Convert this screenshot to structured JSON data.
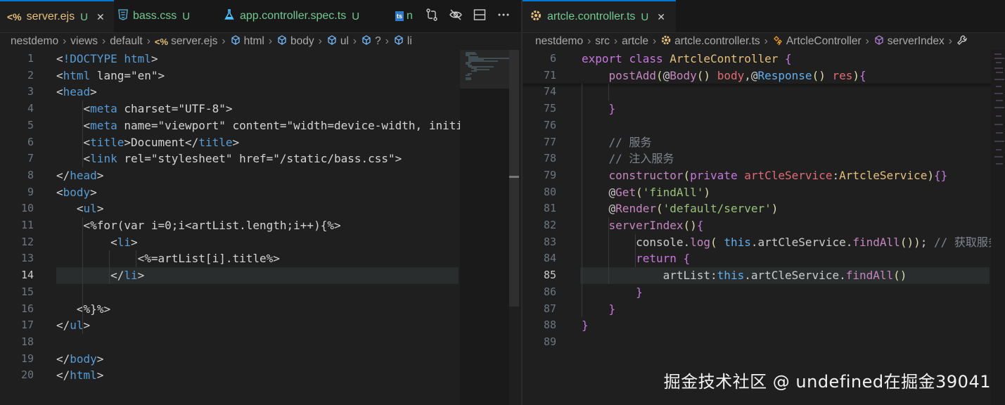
{
  "left_editor": {
    "tabs": [
      {
        "icon": "<%",
        "label": "server.ejs",
        "status": "U",
        "close": "✕",
        "active": true
      },
      {
        "icon": "css-icon",
        "label": "bass.css",
        "status": "U",
        "active": false
      },
      {
        "icon": "flask-icon",
        "label": "app.controller.spec.ts",
        "status": "U",
        "active": false
      },
      {
        "icon": "ts",
        "label": "n",
        "active": false
      }
    ],
    "breadcrumb": [
      "nestdemo",
      "views",
      "default",
      "server.ejs",
      "html",
      "body",
      "ul",
      "?",
      "li"
    ],
    "breadcrumb_ejs_icon": "<%",
    "lines": [
      {
        "n": "1",
        "text": "<!DOCTYPE html>"
      },
      {
        "n": "2",
        "text": "<html lang=\"en\">"
      },
      {
        "n": "3",
        "text": "<head>"
      },
      {
        "n": "4",
        "text": "    <meta charset=\"UTF-8\">"
      },
      {
        "n": "5",
        "text": "    <meta name=\"viewport\" content=\"width=device-width, initi"
      },
      {
        "n": "6",
        "text": "    <title>Document</title>"
      },
      {
        "n": "7",
        "text": "    <link rel=\"stylesheet\" href=\"/static/bass.css\">"
      },
      {
        "n": "8",
        "text": "</head>"
      },
      {
        "n": "9",
        "text": "<body>"
      },
      {
        "n": "10",
        "text": "   <ul>"
      },
      {
        "n": "11",
        "text": "    <%for(var i=0;i<artList.length;i++){%>"
      },
      {
        "n": "12",
        "text": "        <li>"
      },
      {
        "n": "13",
        "text": "            <%=artList[i].title%>"
      },
      {
        "n": "14",
        "text": "        </li>"
      },
      {
        "n": "15",
        "text": ""
      },
      {
        "n": "16",
        "text": "   <%}%>"
      },
      {
        "n": "17",
        "text": "</ul>"
      },
      {
        "n": "18",
        "text": ""
      },
      {
        "n": "19",
        "text": "</body>"
      },
      {
        "n": "20",
        "text": "</html>"
      }
    ],
    "current_line": "14"
  },
  "right_editor": {
    "tab": {
      "label": "artcle.controller.ts",
      "status": "U",
      "close": "✕"
    },
    "breadcrumb": [
      "nestdemo",
      "src",
      "artcle",
      "artcle.controller.ts",
      "ArtcleController",
      "serverIndex"
    ],
    "sticky_lines": [
      {
        "n": "6",
        "text": "export class ArtcleController {"
      },
      {
        "n": "71",
        "text": "    postAdd(@Body() body,@Response() res){"
      }
    ],
    "lines": [
      {
        "n": "74",
        "text": ""
      },
      {
        "n": "75",
        "text": "    }"
      },
      {
        "n": "76",
        "text": ""
      },
      {
        "n": "77",
        "text": "    // 服务"
      },
      {
        "n": "78",
        "text": "    // 注入服务"
      },
      {
        "n": "79",
        "text": "    constructor(private artCleService:ArtcleService){}"
      },
      {
        "n": "80",
        "text": "    @Get('findAll')"
      },
      {
        "n": "81",
        "text": "    @Render('default/server')"
      },
      {
        "n": "82",
        "text": "    serverIndex(){"
      },
      {
        "n": "83",
        "text": "        console.log( this.artCleService.findAll()); // 获取服务"
      },
      {
        "n": "84",
        "text": "        return {"
      },
      {
        "n": "85",
        "text": "            artList:this.artCleService.findAll()"
      },
      {
        "n": "86",
        "text": "        }"
      },
      {
        "n": "87",
        "text": "    }"
      },
      {
        "n": "88",
        "text": "}"
      },
      {
        "n": "89",
        "text": ""
      }
    ],
    "current_line": "85"
  },
  "watermark": "掘金技术社区 @ undefined在掘金39041",
  "colors": {
    "editor_bg": "#1f1f1f",
    "tab_active_border": "#0078d4",
    "modified_u": "#73c991",
    "ejs_icon": "#e5c07b",
    "css_icon": "#519aba",
    "ts_icon": "#3178c6"
  }
}
